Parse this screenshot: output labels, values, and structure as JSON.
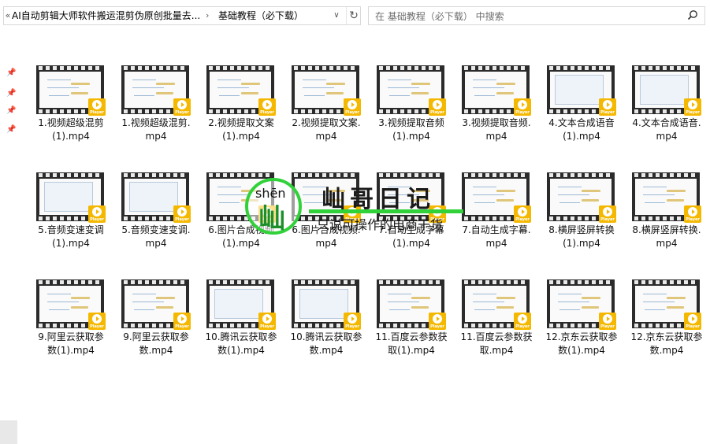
{
  "address_bar": {
    "back_glyph": "«",
    "crumb_parent": "AI自动剪辑大师软件搬运混剪伪原创批量去...",
    "separator": "›",
    "crumb_current": "基础教程（必下载）",
    "dropdown_icon": "chevron-down-icon",
    "refresh_icon": "refresh-icon"
  },
  "search": {
    "placeholder": "在 基础教程（必下载） 中搜索",
    "icon": "search-icon"
  },
  "nav_pins": [
    "pin-icon",
    "pin-icon",
    "pin-icon",
    "pin-icon"
  ],
  "player_badge": "Player",
  "files": [
    {
      "line1": "1.视频超级混剪",
      "line2": "(1).mp4"
    },
    {
      "line1": "1.视频超级混剪.",
      "line2": "mp4"
    },
    {
      "line1": "2.视频提取文案",
      "line2": "(1).mp4"
    },
    {
      "line1": "2.视频提取文案.",
      "line2": "mp4"
    },
    {
      "line1": "3.视频提取音频",
      "line2": "(1).mp4"
    },
    {
      "line1": "3.视频提取音频.",
      "line2": "mp4"
    },
    {
      "line1": "4.文本合成语音",
      "line2": "(1).mp4"
    },
    {
      "line1": "4.文本合成语音.",
      "line2": "mp4"
    },
    {
      "line1": "5.音频变速变调",
      "line2": "(1).mp4"
    },
    {
      "line1": "5.音频变速变调.",
      "line2": "mp4"
    },
    {
      "line1": "6.图片合成视频",
      "line2": "(1).mp4"
    },
    {
      "line1": "6.图片合成视频.",
      "line2": "mp4"
    },
    {
      "line1": "7.自动生成字幕",
      "line2": "(1).mp4"
    },
    {
      "line1": "7.自动生成字幕.",
      "line2": "mp4"
    },
    {
      "line1": "8.横屏竖屏转换",
      "line2": "(1).mp4"
    },
    {
      "line1": "8.横屏竖屏转换.",
      "line2": "mp4"
    },
    {
      "line1": "9.阿里云获取参",
      "line2": "数(1).mp4"
    },
    {
      "line1": "9.阿里云获取参",
      "line2": "数.mp4"
    },
    {
      "line1": "10.腾讯云获取参",
      "line2": "数(1).mp4"
    },
    {
      "line1": "10.腾讯云获取参",
      "line2": "数.mp4"
    },
    {
      "line1": "11.百度云参数获",
      "line2": "取(1).mp4"
    },
    {
      "line1": "11.百度云参数获",
      "line2": "取.mp4"
    },
    {
      "line1": "12.京东云获取参",
      "line2": "数(1).mp4"
    },
    {
      "line1": "12.京东云获取参",
      "line2": "数.mp4"
    }
  ],
  "watermark": {
    "pinyin": "shēn",
    "char": "屾",
    "title": "屾哥日记",
    "subtitle": "只说可操作的电商干货",
    "accent_color": "#31d13a"
  }
}
